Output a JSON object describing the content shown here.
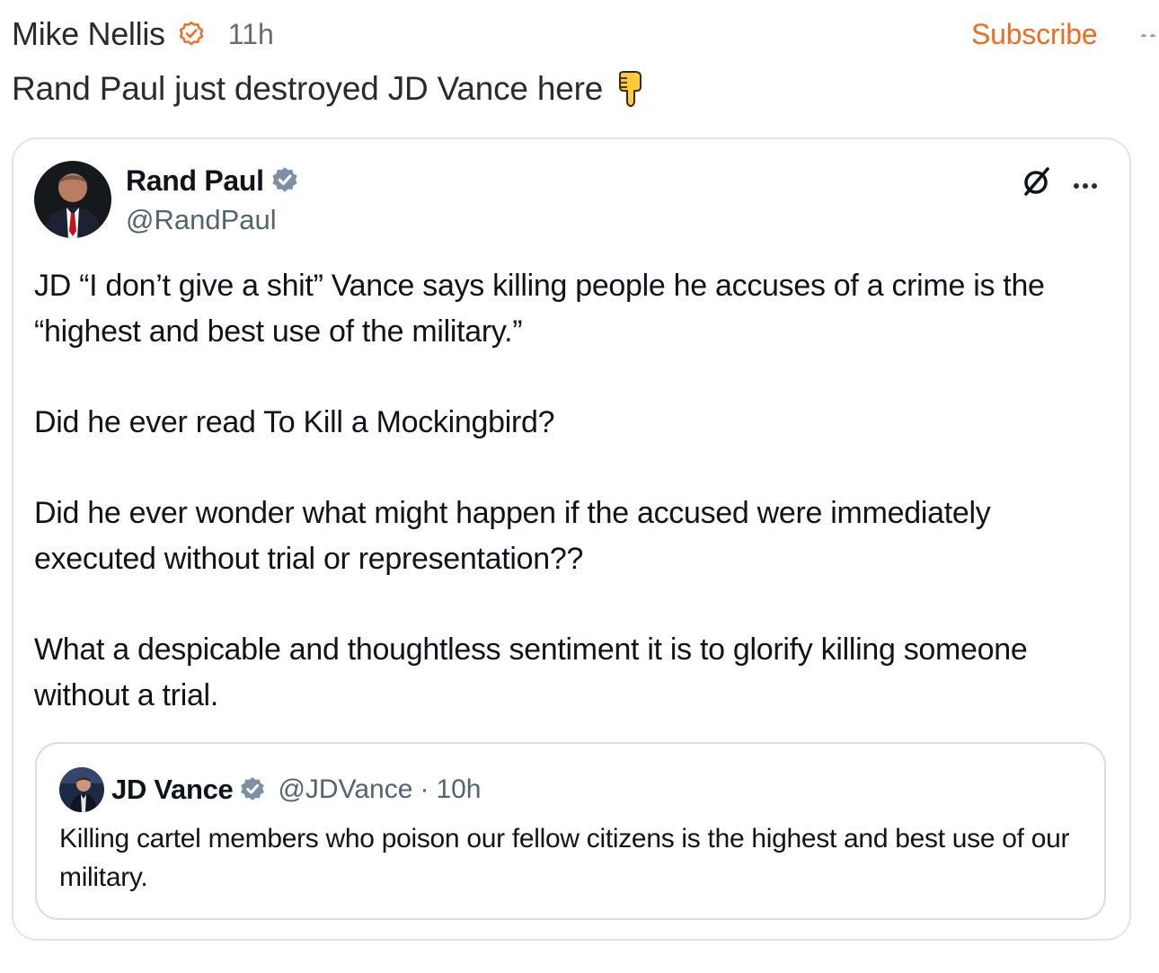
{
  "note": {
    "author": "Mike Nellis",
    "verified_icon": "orange-verified-badge",
    "time": "11h",
    "subscribe_label": "Subscribe",
    "more_icon": "more-dots",
    "body_text": "Rand Paul just destroyed JD Vance here",
    "body_emoji": "backhand-index-pointing-down"
  },
  "embed": {
    "author_name": "Rand Paul",
    "handle": "@RandPaul",
    "verified_icon": "blue-verified-badge",
    "platform_icon": "x-logo",
    "more_icon": "more-dots",
    "paragraphs": [
      "JD “I don’t give a shit” Vance says killing people he accuses of a crime is the “highest and best use of the military.”",
      "Did he ever read To Kill a Mockingbird?",
      "Did he ever wonder what might happen if the accused were immediately executed without trial or representation??",
      "What a despicable and thoughtless sentiment it is to glorify killing someone without a trial."
    ],
    "quoted": {
      "author_name": "JD Vance",
      "handle": "@JDVance",
      "separator": "·",
      "time": "10h",
      "text": "Killing cartel members who poison our fellow citizens is the highest and best use of our military."
    }
  },
  "colors": {
    "subscribe_accent": "#ef6b1f",
    "blue_check": "#7d8fa3",
    "muted_text": "#536471"
  }
}
